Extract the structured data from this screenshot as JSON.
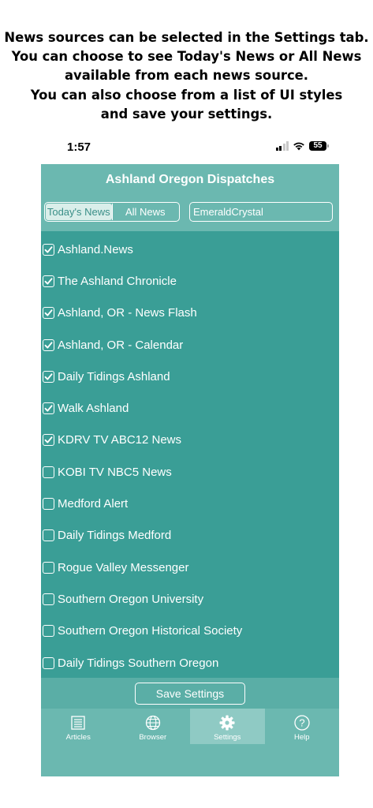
{
  "caption": [
    "News sources can be selected in the Settings tab.",
    "You can choose to see Today's News or All News",
    "available from each news source.",
    "You can also choose from a list of UI styles",
    "and save your settings."
  ],
  "status": {
    "time": "1:57",
    "battery": "55"
  },
  "app": {
    "title": "Ashland Oregon Dispatches",
    "segment": {
      "options": [
        "Today's News",
        "All News"
      ],
      "selected": "Today's News"
    },
    "style_field": "EmeraldCrystal"
  },
  "sources": [
    {
      "label": "Ashland.News",
      "checked": true
    },
    {
      "label": "The Ashland Chronicle",
      "checked": true
    },
    {
      "label": "Ashland, OR - News Flash",
      "checked": true
    },
    {
      "label": "Ashland, OR - Calendar",
      "checked": true
    },
    {
      "label": "Daily Tidings Ashland",
      "checked": true
    },
    {
      "label": "Walk Ashland",
      "checked": true
    },
    {
      "label": "KDRV TV ABC12 News",
      "checked": true
    },
    {
      "label": "KOBI TV NBC5 News",
      "checked": false
    },
    {
      "label": "Medford Alert",
      "checked": false
    },
    {
      "label": "Daily Tidings Medford",
      "checked": false
    },
    {
      "label": "Rogue Valley Messenger",
      "checked": false
    },
    {
      "label": "Southern Oregon University",
      "checked": false
    },
    {
      "label": "Southern Oregon Historical Society",
      "checked": false
    },
    {
      "label": "Daily Tidings Southern Oregon",
      "checked": false
    }
  ],
  "save_label": "Save Settings",
  "tabs": [
    {
      "label": "Articles",
      "icon": "articles-icon",
      "active": false
    },
    {
      "label": "Browser",
      "icon": "globe-icon",
      "active": false
    },
    {
      "label": "Settings",
      "icon": "gear-icon",
      "active": true
    },
    {
      "label": "Help",
      "icon": "help-icon",
      "active": false
    }
  ],
  "colors": {
    "accent": "#3a9e96",
    "header": "#6bb8b0"
  }
}
